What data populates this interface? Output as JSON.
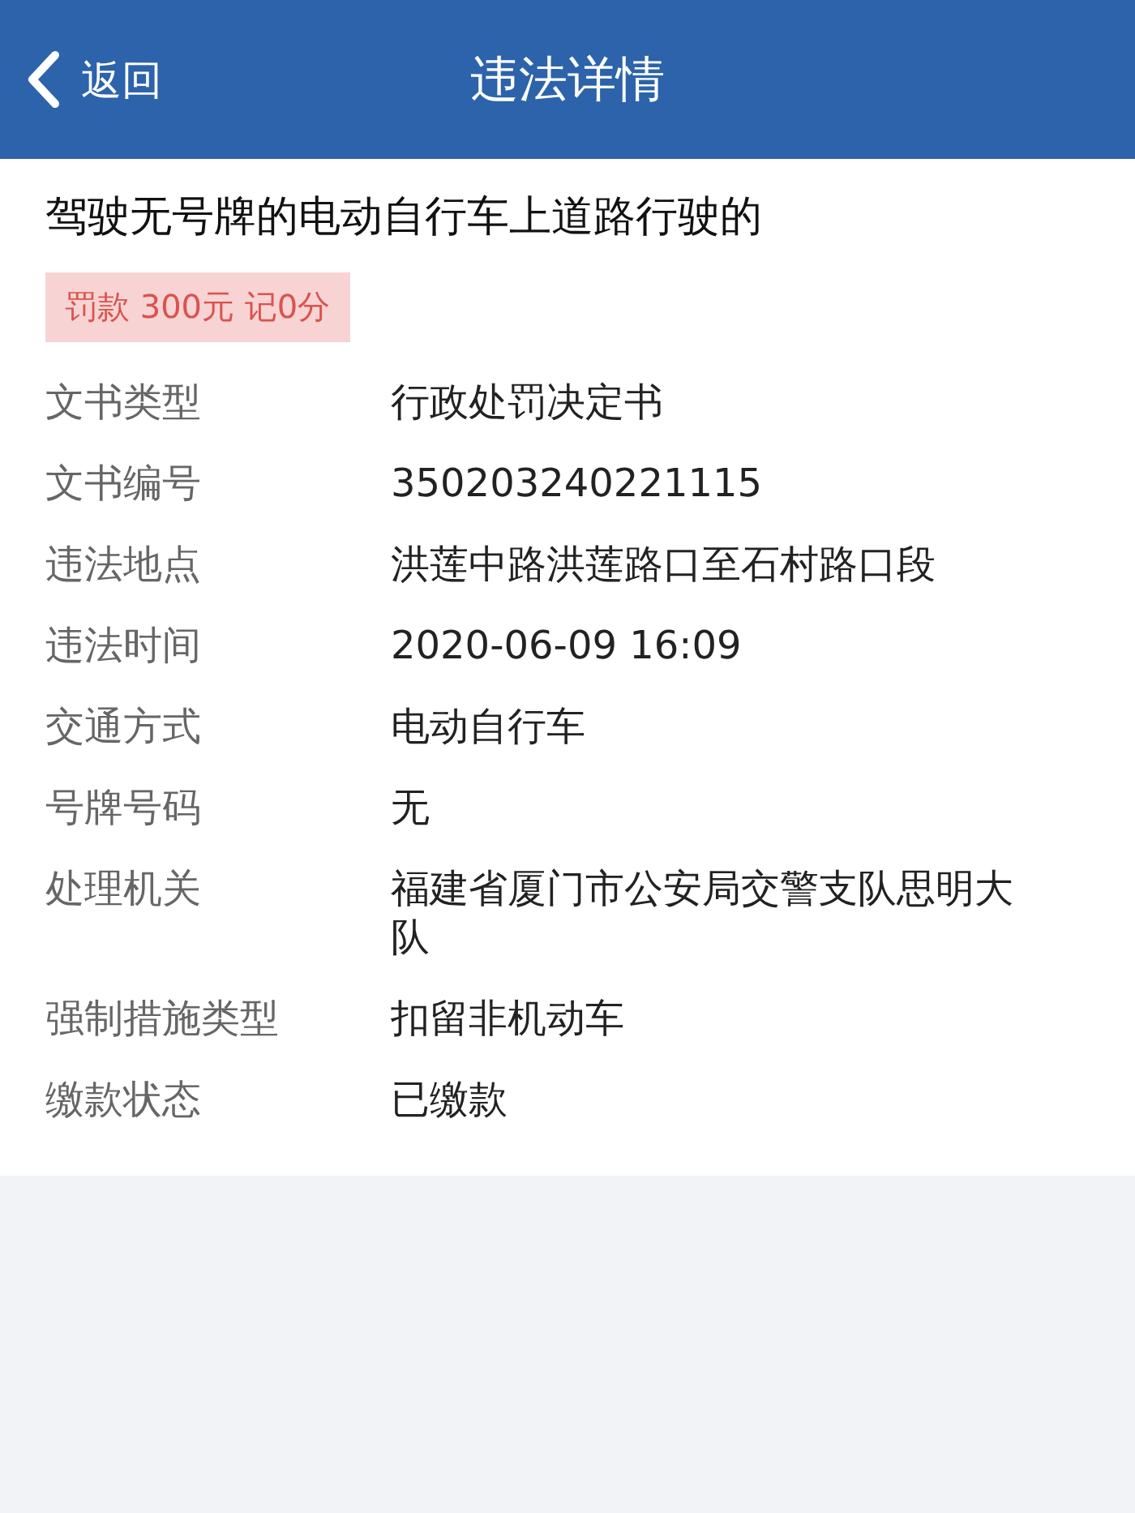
{
  "nav": {
    "back_label": "返回",
    "title": "违法详情"
  },
  "violation": {
    "title": "驾驶无号牌的电动自行车上道路行驶的",
    "penalty": "罚款 300元 记0分"
  },
  "details": [
    {
      "label": "文书类型",
      "value": "行政处罚决定书"
    },
    {
      "label": "文书编号",
      "value": "350203240221115"
    },
    {
      "label": "违法地点",
      "value": "洪莲中路洪莲路口至石村路口段"
    },
    {
      "label": "违法时间",
      "value": "2020-06-09 16:09"
    },
    {
      "label": "交通方式",
      "value": "电动自行车"
    },
    {
      "label": "号牌号码",
      "value": "无"
    },
    {
      "label": "处理机关",
      "value": "福建省厦门市公安局交警支队思明大队"
    },
    {
      "label": "强制措施类型",
      "value": "扣留非机动车"
    },
    {
      "label": "缴款状态",
      "value": "已缴款"
    }
  ]
}
